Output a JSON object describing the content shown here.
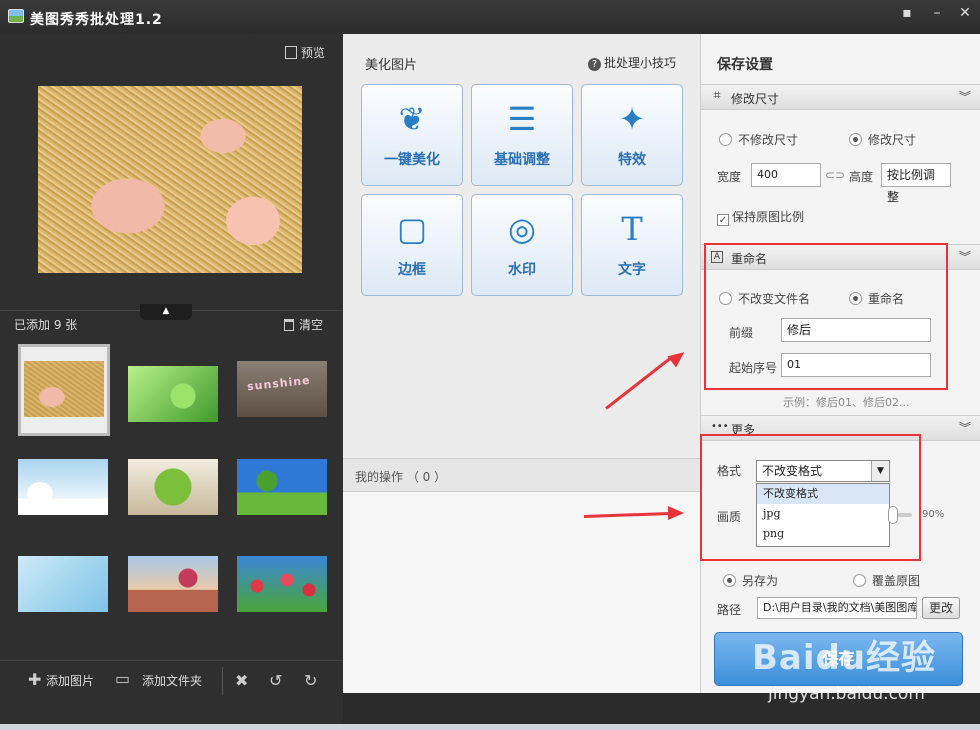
{
  "window": {
    "title": "美图秀秀批处理1.2",
    "buttons": [
      "▪",
      "–",
      "✕"
    ]
  },
  "left": {
    "preview_label": "预览",
    "added_count": "已添加 9 张",
    "clear_label": "清空",
    "add_image": "添加图片",
    "add_folder": "添加文件夹",
    "thumb3_word": "sunshine"
  },
  "middle": {
    "title": "美化图片",
    "tips": "批处理小技巧",
    "tools": [
      {
        "label": "一键美化",
        "icon": "tulip-icon"
      },
      {
        "label": "基础调整",
        "icon": "sliders-icon"
      },
      {
        "label": "特效",
        "icon": "magic-wand-icon"
      },
      {
        "label": "边框",
        "icon": "frame-icon"
      },
      {
        "label": "水印",
        "icon": "watermark-icon"
      },
      {
        "label": "文字",
        "icon": "text-icon"
      }
    ],
    "ops_title": "我的操作 （ 0 ）"
  },
  "right": {
    "title": "保存设置",
    "resize": {
      "header": "修改尺寸",
      "opt_keep": "不修改尺寸",
      "opt_change": "修改尺寸",
      "width_label": "宽度",
      "width_value": "400",
      "height_label": "高度",
      "height_value": "按比例调整",
      "keep_ratio": "保持原图比例"
    },
    "rename": {
      "header": "重命名",
      "opt_keep": "不改变文件名",
      "opt_rename": "重命名",
      "prefix_label": "前缀",
      "prefix_value": "修后",
      "start_label": "起始序号",
      "start_value": "01",
      "example": "示例：修后01、修后02..."
    },
    "more": {
      "header": "更多",
      "format_label": "格式",
      "format_selected": "不改变格式",
      "format_options": [
        "不改变格式",
        "jpg",
        "png"
      ],
      "quality_label": "画质",
      "quality_value": "90%"
    },
    "save_as": "另存为",
    "overwrite": "覆盖原图",
    "path_label": "路径",
    "path_value": "D:\\用户目录\\我的文档\\美图图库",
    "change_btn": "更改",
    "save_btn": "保存"
  },
  "watermark": {
    "brand": "Baidu经验",
    "url": "jingyan.baidu.com"
  },
  "colors": {
    "accent": "#2a7ec5",
    "highlight_red": "#e8333a",
    "save_button": "#4a98e0"
  }
}
